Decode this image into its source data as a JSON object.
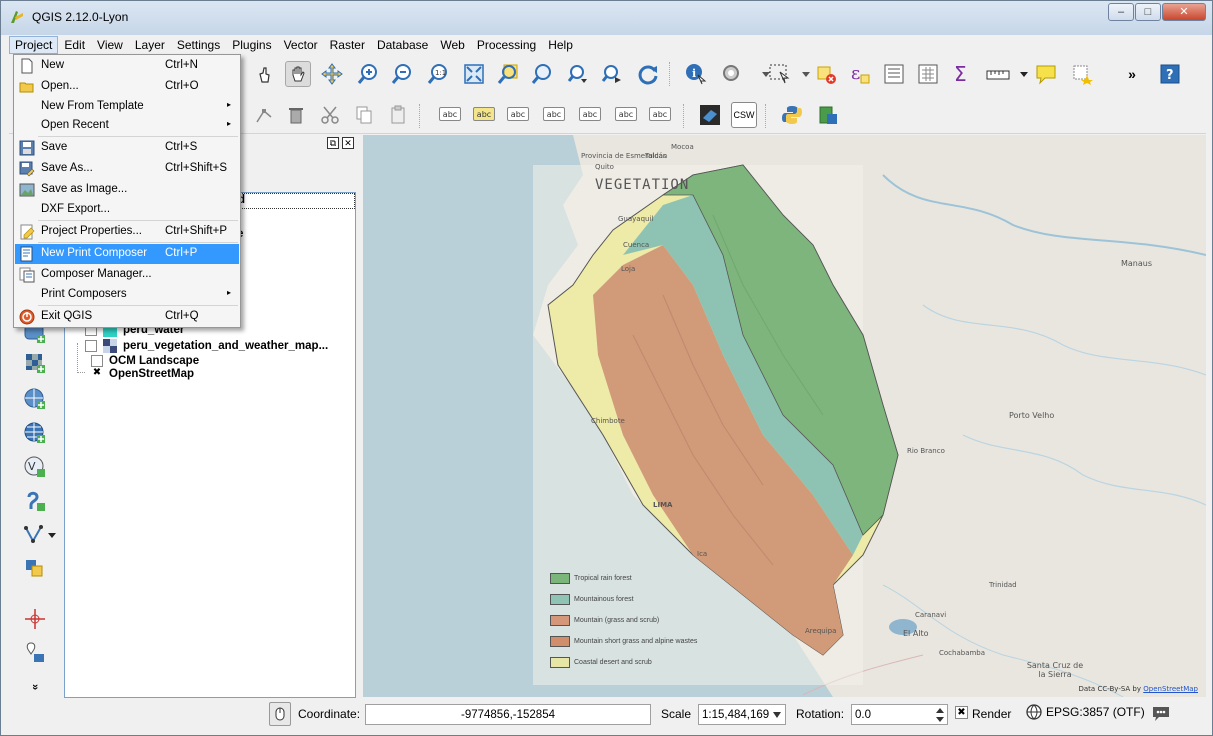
{
  "window": {
    "title": "QGIS 2.12.0-Lyon",
    "controls": {
      "minimize": "–",
      "maximize": "□",
      "close": "✕"
    }
  },
  "menubar": [
    "Project",
    "Edit",
    "View",
    "Layer",
    "Settings",
    "Plugins",
    "Vector",
    "Raster",
    "Database",
    "Web",
    "Processing",
    "Help"
  ],
  "project_menu": {
    "items": [
      {
        "label": "New",
        "shortcut": "Ctrl+N",
        "icon": "new-project-icon"
      },
      {
        "label": "Open...",
        "shortcut": "Ctrl+O",
        "icon": "open-folder-icon"
      },
      {
        "label": "New From Template",
        "shortcut": "",
        "submenu": true
      },
      {
        "label": "Open Recent",
        "shortcut": "",
        "submenu": true
      },
      {
        "label": "Save",
        "shortcut": "Ctrl+S",
        "icon": "save-icon"
      },
      {
        "label": "Save As...",
        "shortcut": "Ctrl+Shift+S",
        "icon": "save-as-icon"
      },
      {
        "label": "Save as Image...",
        "shortcut": "",
        "icon": "save-image-icon"
      },
      {
        "label": "DXF Export...",
        "shortcut": ""
      },
      {
        "label": "Project Properties...",
        "shortcut": "Ctrl+Shift+P",
        "icon": "project-properties-icon"
      },
      {
        "label": "New Print Composer",
        "shortcut": "Ctrl+P",
        "icon": "print-composer-icon",
        "highlighted": true
      },
      {
        "label": "Composer Manager...",
        "shortcut": "",
        "icon": "composer-manager-icon"
      },
      {
        "label": "Print Composers",
        "shortcut": "",
        "submenu": true
      },
      {
        "label": "Exit QGIS",
        "shortcut": "Ctrl+Q",
        "icon": "exit-icon"
      }
    ]
  },
  "layers": {
    "partial_text": [
      "d",
      "e"
    ],
    "rows": [
      {
        "name": "peru_water",
        "checked": false,
        "icon_color": "#2ed3c5"
      },
      {
        "name": "peru_vegetation_and_weather_map...",
        "checked": false,
        "icon_color": "#3a4a7a"
      },
      {
        "name": "OCM Landscape",
        "checked": false
      },
      {
        "name": "OpenStreetMap",
        "checked": true,
        "check_mark": "✖"
      }
    ]
  },
  "map": {
    "title": "VEGETATION",
    "legend": [
      {
        "label": "Tropical rain forest",
        "color": "#7ab67a"
      },
      {
        "label": "Mountainous forest",
        "color": "#8fc4b4"
      },
      {
        "label": "Mountain (grass and scrub)",
        "color": "#d4977a"
      },
      {
        "label": "Mountain short grass and alpine wastes",
        "color": "#d08f6a"
      },
      {
        "label": "Coastal desert and scrub",
        "color": "#e6e6a6"
      }
    ],
    "places": [
      "Provincia de Esmeraldas",
      "Tulcán",
      "Mocoa",
      "Quito",
      "Manaus",
      "Porto Velho",
      "Rio Branco",
      "Chimbote",
      "LIMA",
      "Ica",
      "Arequipa",
      "El Alto",
      "Trinidad",
      "Santa Cruz de la Sierra",
      "Cochabamba",
      "Caranavi",
      "Guayaquil",
      "Cuenca",
      "Loja"
    ],
    "attribution": "Data CC-By-SA by",
    "attribution_link": "OpenStreetMap"
  },
  "statusbar": {
    "coordinate_label": "Coordinate:",
    "coordinate_value": "-9774856,-152854",
    "scale_label": "Scale",
    "scale_value": "1:15,484,169",
    "rotation_label": "Rotation:",
    "rotation_value": "0.0",
    "render_label": "Render",
    "render_check": "✖",
    "crs_label": "EPSG:3857 (OTF)"
  },
  "toolbar": {
    "more_glyph": "»",
    "csw_label": "CSW",
    "abc_label": "abc",
    "epsilon": "ε",
    "sigma": "Σ"
  },
  "left_toolbar": {
    "more_glyph": "»"
  }
}
